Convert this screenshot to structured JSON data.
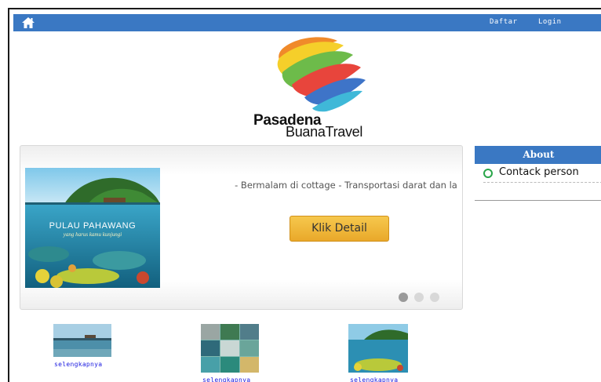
{
  "topbar": {
    "icon": "home-icon",
    "links": [
      "Daftar",
      "Login"
    ],
    "color": "#3a78c3"
  },
  "brand": {
    "line1": "Pasadena",
    "line2": "BuanaTravel"
  },
  "slider": {
    "image_caption_title": "PULAU PAHAWANG",
    "image_caption_subtitle": "yang harus kamu kunjungi",
    "description": "- Bermalam di cottage - Transportasi darat dan la",
    "button_label": "Klik Detail",
    "active_slide": 1,
    "slide_count": 3
  },
  "sidebar": {
    "title": "About",
    "items": [
      {
        "icon": "circle-bullet-icon",
        "label": "Contack person"
      }
    ]
  },
  "thumbnails": [
    {
      "link": "selengkapnya"
    },
    {
      "link": "selengkapnya"
    },
    {
      "link": "selengkapnya"
    }
  ],
  "colors": {
    "accent": "#3a78c3",
    "button": "#f0b83a",
    "bullet": "#2aa64a",
    "link": "#1a1ae0"
  }
}
